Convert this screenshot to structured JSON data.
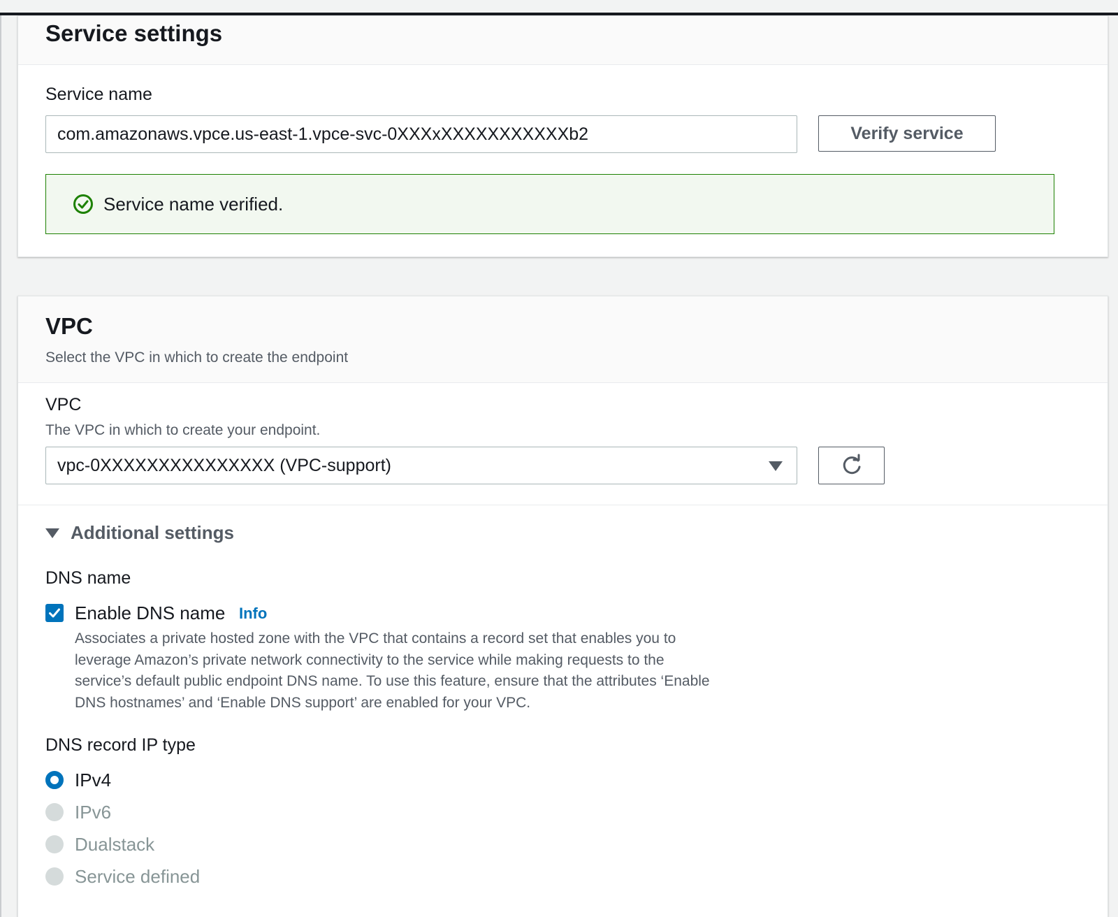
{
  "service_settings": {
    "title": "Service settings",
    "service_name_label": "Service name",
    "service_name_value": "com.amazonaws.vpce.us-east-1.vpce-svc-0XXXxXXXXXXXXXXXb2",
    "verify_button": "Verify service",
    "alert_text": "Service name verified."
  },
  "vpc_section": {
    "title": "VPC",
    "subtitle": "Select the VPC in which to create the endpoint",
    "vpc_label": "VPC",
    "vpc_description": "The VPC in which to create your endpoint.",
    "vpc_value": "vpc-0XXXXXXXXXXXXXXX (VPC-support)",
    "additional_settings": "Additional settings",
    "dns_name_label": "DNS name",
    "enable_dns_label": "Enable DNS name",
    "info_link": "Info",
    "dns_description_lines": [
      "Associates a private hosted zone with the VPC that contains a record set that enables you to",
      "leverage Amazon’s private network connectivity to the service while making requests to the",
      "service’s default public endpoint DNS name. To use this feature, ensure that the attributes ‘Enable",
      "DNS hostnames’ and ‘Enable DNS support’ are enabled for your VPC."
    ],
    "dns_record_ip_type_label": "DNS record IP type",
    "ip_types": [
      {
        "label": "IPv4",
        "selected": true,
        "enabled": true
      },
      {
        "label": "IPv6",
        "selected": false,
        "enabled": false
      },
      {
        "label": "Dualstack",
        "selected": false,
        "enabled": false
      },
      {
        "label": "Service defined",
        "selected": false,
        "enabled": false
      }
    ]
  },
  "icons": {
    "success": "check-circle-icon",
    "refresh": "refresh-icon",
    "dropdown": "caret-down-icon",
    "expander": "caret-down-icon",
    "checkbox": "checkmark-icon"
  },
  "colors": {
    "accent": "#0073bb",
    "success": "#1d8102",
    "success_bg": "#f2f8f0",
    "text": "#16191f",
    "muted": "#545b64",
    "disabled": "#879596"
  }
}
